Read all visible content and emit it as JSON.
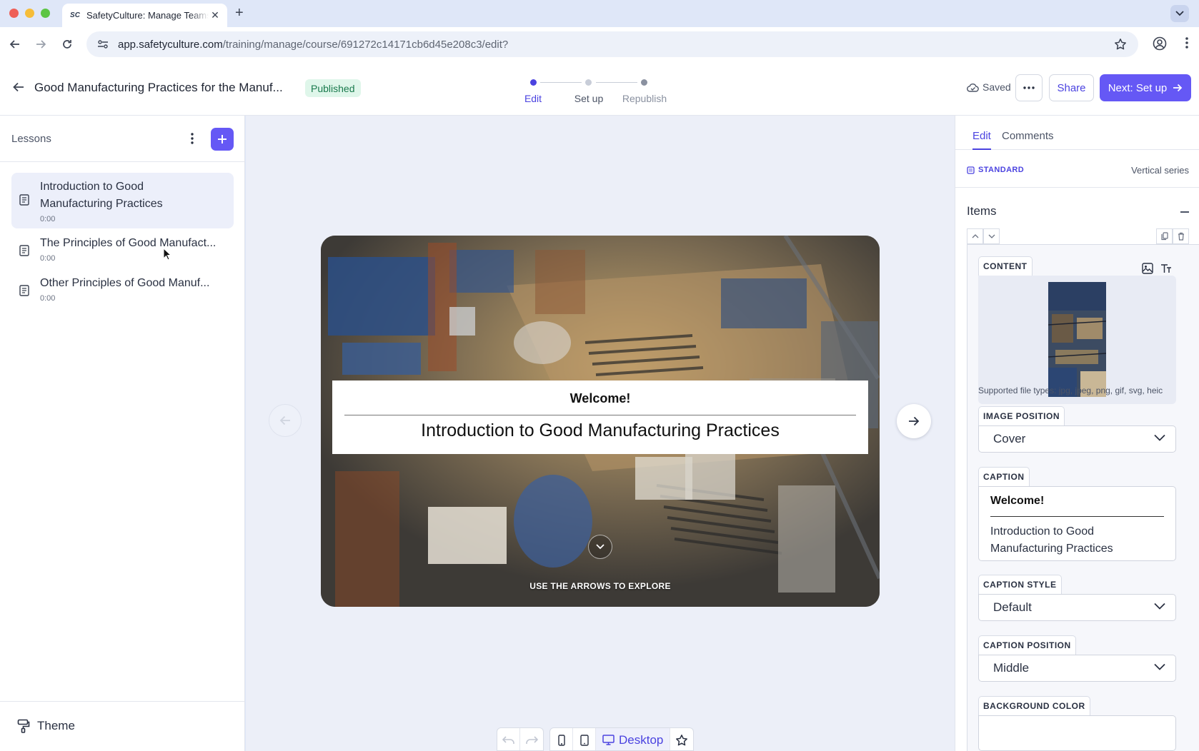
{
  "browser": {
    "tab_title": "SafetyCulture: Manage Teams",
    "favicon_text": "SC",
    "url_domain": "app.safetyculture.com",
    "url_path": "/training/manage/course/691272c14171cb6d45e208c3/edit?"
  },
  "header": {
    "course_title": "Good Manufacturing Practices for the Manuf...",
    "status": "Published",
    "steps": [
      {
        "label": "Edit",
        "state": "current"
      },
      {
        "label": "Set up",
        "state": "next"
      },
      {
        "label": "Republish",
        "state": "later"
      }
    ],
    "saved_label": "Saved",
    "share_label": "Share",
    "next_label": "Next: Set up"
  },
  "sidebar": {
    "title": "Lessons",
    "lessons": [
      {
        "title_line1": "Introduction to Good",
        "title_line2": "Manufacturing Practices",
        "duration": "0:00",
        "active": true
      },
      {
        "title_line1": "The Principles of Good Manufact...",
        "duration": "0:00",
        "active": false
      },
      {
        "title_line1": "Other Principles of Good Manuf...",
        "duration": "0:00",
        "active": false
      }
    ],
    "theme_label": "Theme"
  },
  "slide": {
    "caption_heading": "Welcome!",
    "caption_body": "Introduction to Good Manufacturing Practices",
    "explore_hint": "USE THE ARROWS TO EXPLORE"
  },
  "view_bar": {
    "selected_label": "Desktop"
  },
  "panel": {
    "tabs": [
      "Edit",
      "Comments"
    ],
    "active_tab": "Edit",
    "block_type": "STANDARD",
    "series_type": "Vertical series",
    "items_title": "Items",
    "content_label": "CONTENT",
    "file_types": "Supported file types: jpg, jpeg, png, gif, svg, heic",
    "image_position_label": "IMAGE POSITION",
    "image_position_value": "Cover",
    "caption_label": "CAPTION",
    "caption_heading": "Welcome!",
    "caption_body": "Introduction to Good Manufacturing Practices",
    "caption_style_label": "CAPTION STYLE",
    "caption_style_value": "Default",
    "caption_position_label": "CAPTION POSITION",
    "caption_position_value": "Middle",
    "background_color_label": "BACKGROUND COLOR"
  },
  "colors": {
    "accent": "#6558f5",
    "accent_text": "#4b43e0",
    "published_bg": "#dff6ea",
    "published_text": "#1a7a4d"
  }
}
